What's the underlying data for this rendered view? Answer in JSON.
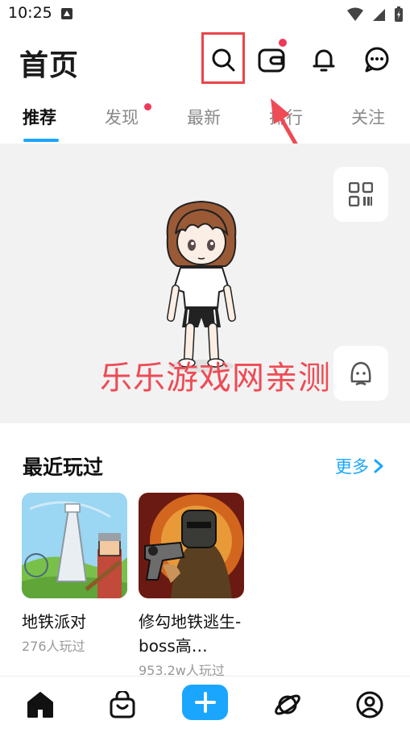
{
  "status": {
    "time": "10:25"
  },
  "header": {
    "title": "首页",
    "icons": [
      "search-icon",
      "wallet-icon",
      "bell-icon",
      "message-icon"
    ]
  },
  "tabs": [
    {
      "label": "推荐",
      "active": true
    },
    {
      "label": "发现",
      "active": false,
      "dot": true
    },
    {
      "label": "最新",
      "active": false
    },
    {
      "label": "排行",
      "active": false
    },
    {
      "label": "关注",
      "active": false
    }
  ],
  "banner": {
    "watermark": "乐乐游戏网亲测",
    "side_buttons": [
      "qr-code-icon",
      "avatar-face-icon"
    ]
  },
  "recent": {
    "title": "最近玩过",
    "more_label": "更多",
    "games": [
      {
        "name": "地铁派对",
        "plays": "276人玩过"
      },
      {
        "name": "修勾地铁逃生-boss高…",
        "plays": "953.2w人玩过"
      }
    ]
  },
  "bottom_nav": {
    "items": [
      "home-icon",
      "bag-icon",
      "plus-icon",
      "planet-icon",
      "profile-icon"
    ]
  },
  "colors": {
    "accent": "#1aa6ff",
    "annotation_red": "#e8454a",
    "dot_red": "#f0395a"
  }
}
